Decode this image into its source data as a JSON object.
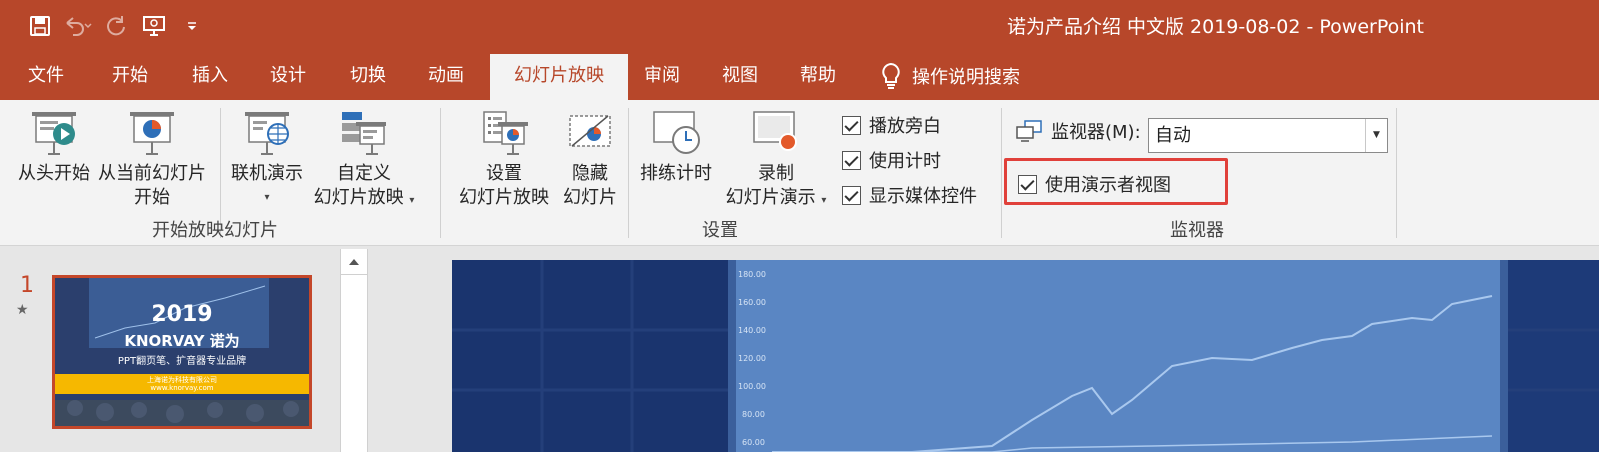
{
  "window": {
    "title": "诺为产品介绍 中文版 2019-08-02  -  PowerPoint"
  },
  "quick_access": [
    "save-icon",
    "undo-icon",
    "redo-icon",
    "present-icon",
    "customize-icon"
  ],
  "tabs": [
    {
      "label": "文件"
    },
    {
      "label": "开始"
    },
    {
      "label": "插入"
    },
    {
      "label": "设计"
    },
    {
      "label": "切换"
    },
    {
      "label": "动画"
    },
    {
      "label": "幻灯片放映",
      "active": true
    },
    {
      "label": "审阅"
    },
    {
      "label": "视图"
    },
    {
      "label": "帮助"
    }
  ],
  "tell_me": "操作说明搜索",
  "ribbon": {
    "start_group": {
      "label": "开始放映幻灯片",
      "from_beginning": "从头开始",
      "from_current_line1": "从当前幻灯片",
      "from_current_line2": "开始",
      "online": "联机演示",
      "custom_line1": "自定义",
      "custom_line2": "幻灯片放映"
    },
    "setup_group": {
      "label": "设置",
      "setup_line1": "设置",
      "setup_line2": "幻灯片放映",
      "hide_line1": "隐藏",
      "hide_line2": "幻灯片",
      "rehearse": "排练计时",
      "record_line1": "录制",
      "record_line2": "幻灯片演示",
      "checkboxes": [
        {
          "label": "播放旁白",
          "checked": true
        },
        {
          "label": "使用计时",
          "checked": true
        },
        {
          "label": "显示媒体控件",
          "checked": true
        }
      ]
    },
    "monitor_group": {
      "label": "监视器",
      "monitor_label": "监视器(M):",
      "monitor_value": "自动",
      "presenter_view": {
        "label": "使用演示者视图",
        "checked": true
      }
    }
  },
  "thumbnails": [
    {
      "number": "1",
      "star": "★",
      "year": "2019",
      "brand": "KNORVAY 诺为",
      "subtitle": "PPT翻页笔、扩音器专业品牌",
      "company": "上海诺为科技有限公司",
      "url": "www.knorvay.com"
    }
  ],
  "slide_axis": [
    "180.00",
    "160.00",
    "140.00",
    "120.00",
    "100.00",
    "80.00",
    "60.00"
  ],
  "colors": {
    "accent": "#b7472a",
    "highlight": "#e0403a"
  }
}
